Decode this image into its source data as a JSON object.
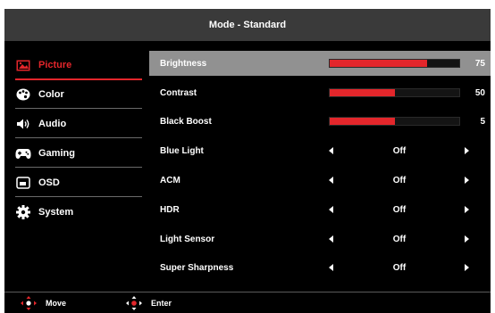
{
  "header": {
    "title": "Mode - Standard"
  },
  "sidebar": {
    "items": [
      {
        "label": "Picture",
        "icon": "picture-icon",
        "active": true
      },
      {
        "label": "Color",
        "icon": "palette-icon",
        "active": false
      },
      {
        "label": "Audio",
        "icon": "speaker-icon",
        "active": false
      },
      {
        "label": "Gaming",
        "icon": "gamepad-icon",
        "active": false
      },
      {
        "label": "OSD",
        "icon": "osd-screen-icon",
        "active": false
      },
      {
        "label": "System",
        "icon": "gear-icon",
        "active": false
      }
    ]
  },
  "settings": {
    "sliders": [
      {
        "label": "Brightness",
        "value": "75",
        "fill_fraction": 0.75
      },
      {
        "label": "Contrast",
        "value": "50",
        "fill_fraction": 0.5
      },
      {
        "label": "Black Boost",
        "value": "5",
        "fill_fraction": 0.5
      }
    ],
    "options": [
      {
        "label": "Blue Light",
        "value": "Off"
      },
      {
        "label": "ACM",
        "value": "Off"
      },
      {
        "label": "HDR",
        "value": "Off"
      },
      {
        "label": "Light Sensor",
        "value": "Off"
      },
      {
        "label": "Super Sharpness",
        "value": "Off"
      }
    ]
  },
  "footer": {
    "move_label": "Move",
    "enter_label": "Enter"
  },
  "colors": {
    "accent": "#e3262b",
    "panel_bg": "#000000",
    "titlebar_bg": "#3a3a3a",
    "highlight_bg": "#919191"
  }
}
